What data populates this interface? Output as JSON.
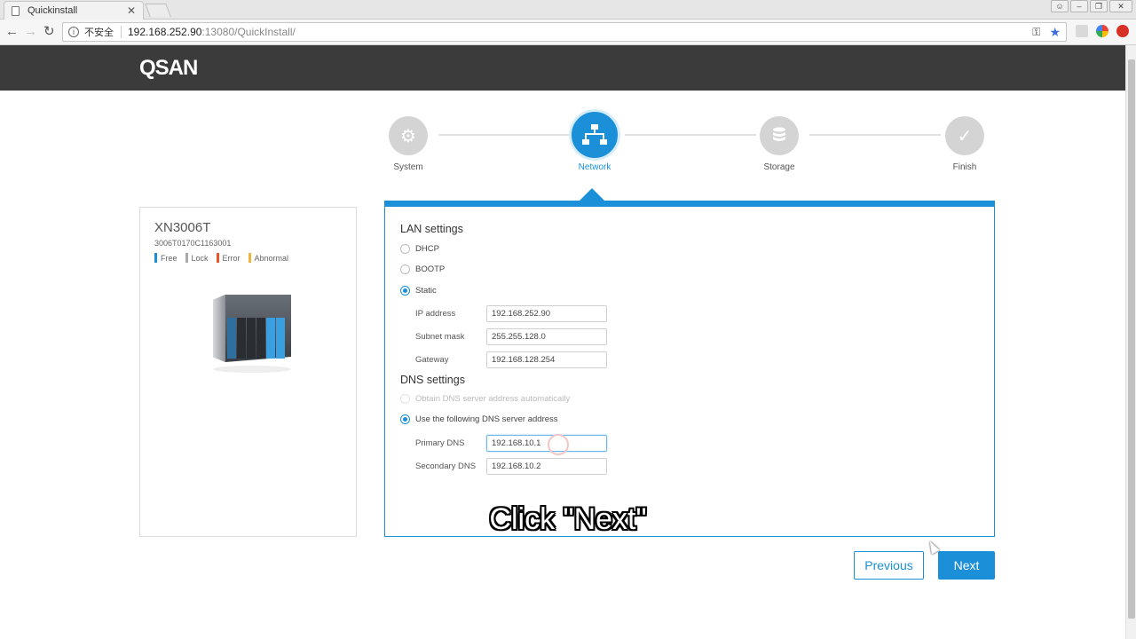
{
  "browser": {
    "tab_title": "Quickinstall",
    "security_text": "不安全",
    "url_host": "192.168.252.90",
    "url_path": ":13080/QuickInstall/"
  },
  "app": {
    "logo": "QSAN"
  },
  "steps": [
    {
      "label": "System",
      "icon": "gear-icon",
      "state": "done"
    },
    {
      "label": "Network",
      "icon": "network-icon",
      "state": "active"
    },
    {
      "label": "Storage",
      "icon": "database-icon",
      "state": "pending"
    },
    {
      "label": "Finish",
      "icon": "check-icon",
      "state": "pending"
    }
  ],
  "device": {
    "model": "XN3006T",
    "serial": "3006T0170C1163001",
    "legend": [
      {
        "label": "Free",
        "color": "#1b8fd8"
      },
      {
        "label": "Lock",
        "color": "#aaaaaa"
      },
      {
        "label": "Error",
        "color": "#e8562a"
      },
      {
        "label": "Abnormal",
        "color": "#f0b43c"
      }
    ]
  },
  "lan": {
    "title": "LAN settings",
    "options": [
      {
        "label": "DHCP",
        "selected": false
      },
      {
        "label": "BOOTP",
        "selected": false
      },
      {
        "label": "Static",
        "selected": true
      }
    ],
    "fields": {
      "ip_label": "IP address",
      "ip_value": "192.168.252.90",
      "mask_label": "Subnet mask",
      "mask_value": "255.255.128.0",
      "gateway_label": "Gateway",
      "gateway_value": "192.168.128.254"
    }
  },
  "dns": {
    "title": "DNS settings",
    "auto_label": "Obtain DNS server address automatically",
    "manual_label": "Use the following DNS server address",
    "primary_label": "Primary DNS",
    "primary_value": "192.168.10.1",
    "secondary_label": "Secondary DNS",
    "secondary_value": "192.168.10.2"
  },
  "buttons": {
    "previous": "Previous",
    "next": "Next"
  },
  "caption": "Click \"Next\"",
  "colors": {
    "accent": "#1b8fd8",
    "header": "#3b3b3b"
  }
}
